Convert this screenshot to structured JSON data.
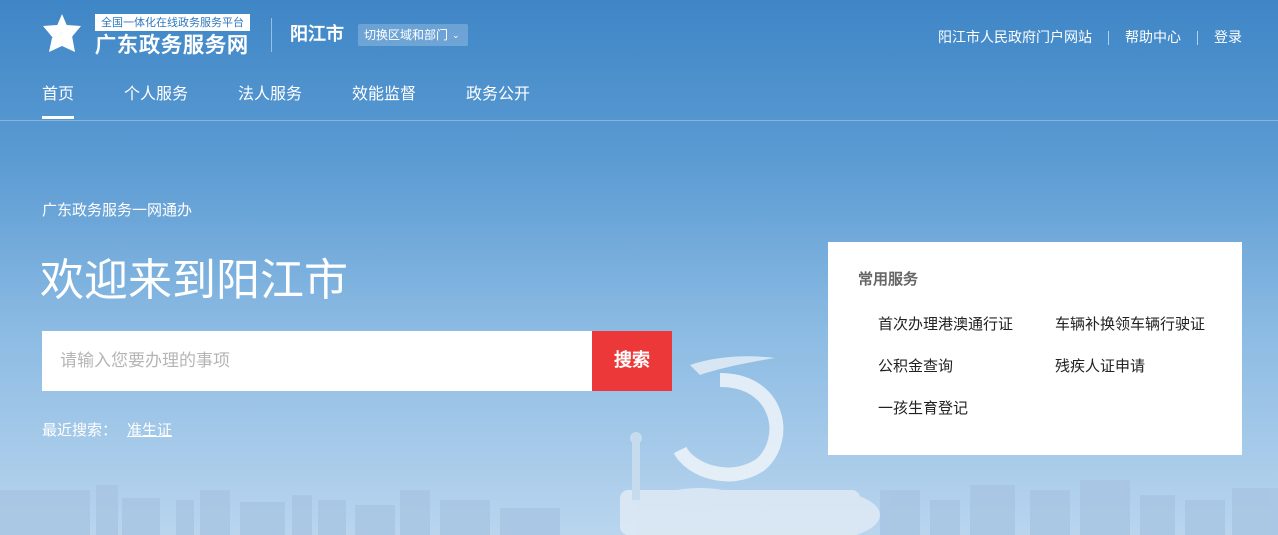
{
  "header": {
    "brand_sub": "全国一体化在线政务服务平台",
    "brand_main": "广东政务服务网",
    "city": "阳江市",
    "switch_label": "切换区域和部门",
    "links": [
      "阳江市人民政府门户网站",
      "帮助中心",
      "登录"
    ]
  },
  "nav": {
    "items": [
      "首页",
      "个人服务",
      "法人服务",
      "效能监督",
      "政务公开"
    ],
    "active": "首页"
  },
  "hero": {
    "slogan": "广东政务服务一网通办",
    "welcome": "欢迎来到阳江市",
    "search_placeholder": "请输入您要办理的事项",
    "search_button": "搜索",
    "recent_label": "最近搜索：",
    "recent_keywords": [
      "准生证"
    ]
  },
  "common_services": {
    "title": "常用服务",
    "items": [
      "首次办理港澳通行证",
      "车辆补换领车辆行驶证",
      "公积金查询",
      "残疾人证申请",
      "一孩生育登记"
    ]
  },
  "colors": {
    "accent_red": "#ec3838",
    "sky_top": "#3f86c6",
    "sky_bottom": "#b9d5ee"
  }
}
